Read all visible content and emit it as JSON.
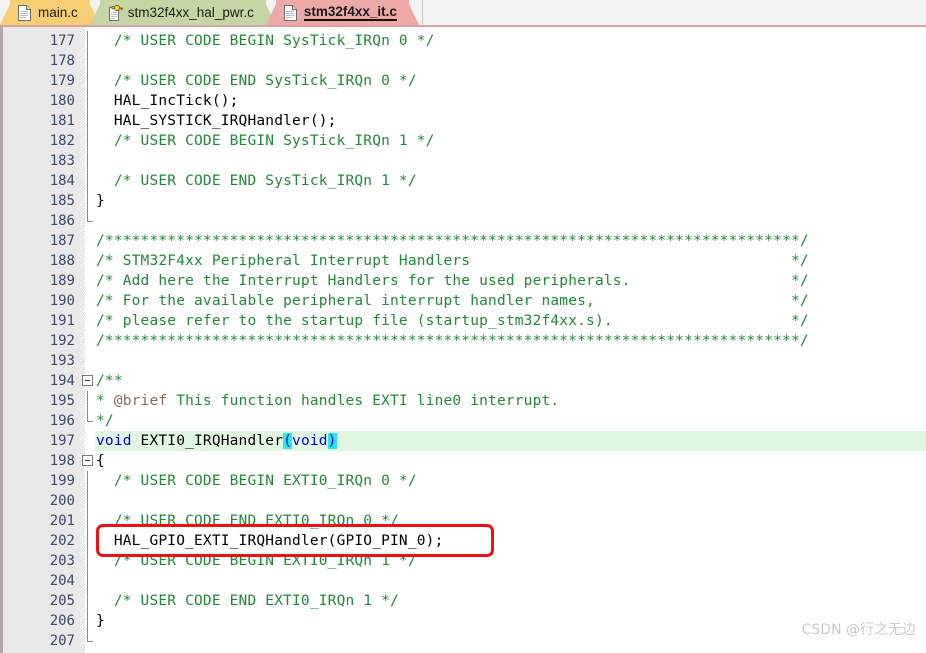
{
  "tabs": [
    {
      "label": "main.c",
      "icon": "file-icon",
      "state": "inactive",
      "color": "#f7ce73"
    },
    {
      "label": "stm32f4xx_hal_pwr.c",
      "icon": "readonly-file-icon",
      "state": "inactive",
      "color": "#c5d6a4"
    },
    {
      "label": "stm32f4xx_it.c",
      "icon": "file-icon",
      "state": "active",
      "color": "#efa8a8"
    }
  ],
  "editor": {
    "first_line": 177,
    "current_line": 197,
    "annotated_line": 202,
    "colors": {
      "comment": "#1f8a37",
      "keyword": "#0000ee",
      "doc_tag": "#8b6b5a",
      "bracket_match": "#25e8e8",
      "current_line_bg": "#e2f7e2",
      "gutter_bg": "#e9e9e9",
      "lineno": "#3b4a66",
      "annotation": "#ee1111"
    },
    "lines": [
      {
        "n": 177,
        "text": "  /* USER CODE BEGIN SysTick_IRQn 0 */",
        "style": "comment"
      },
      {
        "n": 178,
        "text": "",
        "style": "plain"
      },
      {
        "n": 179,
        "text": "  /* USER CODE END SysTick_IRQn 0 */",
        "style": "comment"
      },
      {
        "n": 180,
        "text": "  HAL_IncTick();",
        "style": "plain"
      },
      {
        "n": 181,
        "text": "  HAL_SYSTICK_IRQHandler();",
        "style": "plain"
      },
      {
        "n": 182,
        "text": "  /* USER CODE BEGIN SysTick_IRQn 1 */",
        "style": "comment"
      },
      {
        "n": 183,
        "text": "",
        "style": "plain"
      },
      {
        "n": 184,
        "text": "  /* USER CODE END SysTick_IRQn 1 */",
        "style": "comment"
      },
      {
        "n": 185,
        "text": "}",
        "style": "plain"
      },
      {
        "n": 186,
        "text": "",
        "style": "plain"
      },
      {
        "n": 187,
        "text": "/******************************************************************************/",
        "style": "comment"
      },
      {
        "n": 188,
        "text": "/* STM32F4xx Peripheral Interrupt Handlers                                    */",
        "style": "comment"
      },
      {
        "n": 189,
        "text": "/* Add here the Interrupt Handlers for the used peripherals.                  */",
        "style": "comment"
      },
      {
        "n": 190,
        "text": "/* For the available peripheral interrupt handler names,                      */",
        "style": "comment"
      },
      {
        "n": 191,
        "text": "/* please refer to the startup file (startup_stm32f4xx.s).                    */",
        "style": "comment"
      },
      {
        "n": 192,
        "text": "/******************************************************************************/",
        "style": "comment"
      },
      {
        "n": 193,
        "text": "",
        "style": "plain"
      },
      {
        "n": 194,
        "text": "/**",
        "style": "comment"
      },
      {
        "n": 195,
        "text": "* @brief This function handles EXTI line0 interrupt.",
        "style": "doc"
      },
      {
        "n": 196,
        "text": "*/",
        "style": "comment"
      },
      {
        "n": 197,
        "text": "void EXTI0_IRQHandler(void)",
        "style": "signature"
      },
      {
        "n": 198,
        "text": "{",
        "style": "plain"
      },
      {
        "n": 199,
        "text": "  /* USER CODE BEGIN EXTI0_IRQn 0 */",
        "style": "comment"
      },
      {
        "n": 200,
        "text": "",
        "style": "plain"
      },
      {
        "n": 201,
        "text": "  /* USER CODE END EXTI0_IRQn 0 */",
        "style": "comment"
      },
      {
        "n": 202,
        "text": "  HAL_GPIO_EXTI_IRQHandler(GPIO_PIN_0);",
        "style": "plain"
      },
      {
        "n": 203,
        "text": "  /* USER CODE BEGIN EXTI0_IRQn 1 */",
        "style": "comment"
      },
      {
        "n": 204,
        "text": "",
        "style": "plain"
      },
      {
        "n": 205,
        "text": "  /* USER CODE END EXTI0_IRQn 1 */",
        "style": "comment"
      },
      {
        "n": 206,
        "text": "}",
        "style": "plain"
      },
      {
        "n": 207,
        "text": "",
        "style": "plain"
      }
    ],
    "fold_markers": [
      {
        "line": 177,
        "type": "bar"
      },
      {
        "line": 178,
        "type": "bar"
      },
      {
        "line": 179,
        "type": "bar"
      },
      {
        "line": 180,
        "type": "bar"
      },
      {
        "line": 181,
        "type": "bar"
      },
      {
        "line": 182,
        "type": "bar"
      },
      {
        "line": 183,
        "type": "bar"
      },
      {
        "line": 184,
        "type": "bar"
      },
      {
        "line": 185,
        "type": "bar"
      },
      {
        "line": 186,
        "type": "end"
      },
      {
        "line": 194,
        "type": "collapse"
      },
      {
        "line": 195,
        "type": "bar"
      },
      {
        "line": 196,
        "type": "end"
      },
      {
        "line": 198,
        "type": "collapse"
      },
      {
        "line": 199,
        "type": "bar"
      },
      {
        "line": 200,
        "type": "bar"
      },
      {
        "line": 201,
        "type": "bar"
      },
      {
        "line": 202,
        "type": "bar"
      },
      {
        "line": 203,
        "type": "bar"
      },
      {
        "line": 204,
        "type": "bar"
      },
      {
        "line": 205,
        "type": "bar"
      },
      {
        "line": 206,
        "type": "bar"
      },
      {
        "line": 207,
        "type": "end"
      }
    ]
  },
  "watermark": {
    "text": "CSDN @行之无边"
  }
}
